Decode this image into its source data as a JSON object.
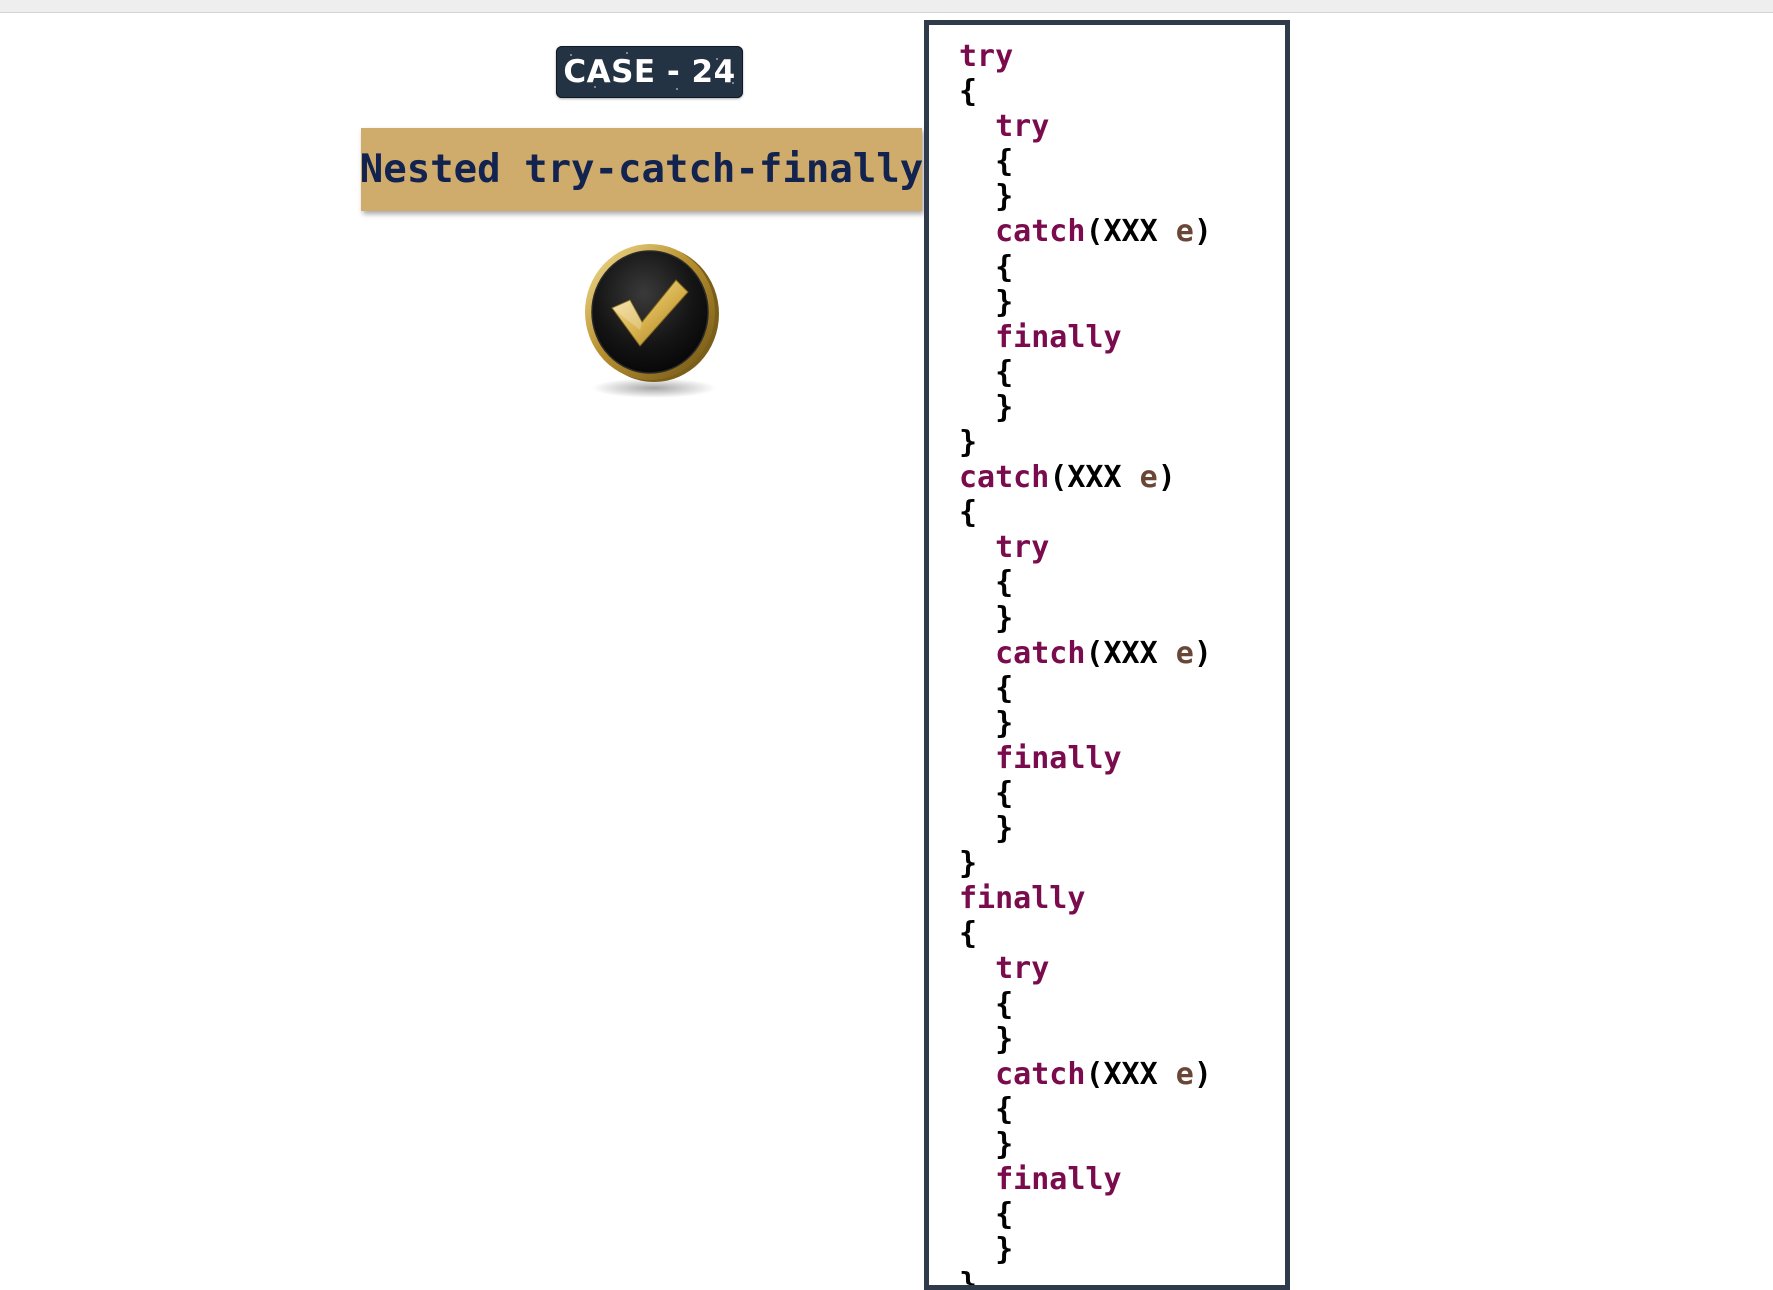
{
  "badge": {
    "label": "CASE - 24"
  },
  "title": {
    "text": "Nested try-catch-finally"
  },
  "icons": {
    "status": "checkmark-coin-icon"
  },
  "colors": {
    "badge_bg": "#243344",
    "banner_bg": "#cfac6b",
    "banner_text": "#13234f",
    "keyword": "#7a0c4e",
    "variable": "#6a4636",
    "panel_border": "#2f3b4a"
  },
  "code": {
    "lines": [
      [
        {
          "t": "kw",
          "v": "try"
        }
      ],
      [
        {
          "t": "punc",
          "v": "{"
        }
      ],
      [
        {
          "t": "kw",
          "v": "  try"
        }
      ],
      [
        {
          "t": "punc",
          "v": "  {"
        }
      ],
      [
        {
          "t": "punc",
          "v": "  }"
        }
      ],
      [
        {
          "t": "kw",
          "v": "  catch"
        },
        {
          "t": "punc",
          "v": "("
        },
        {
          "t": "type",
          "v": "XXX"
        },
        {
          "t": "var",
          "v": " e"
        },
        {
          "t": "punc",
          "v": ")"
        }
      ],
      [
        {
          "t": "punc",
          "v": "  {"
        }
      ],
      [
        {
          "t": "punc",
          "v": "  }"
        }
      ],
      [
        {
          "t": "kw",
          "v": "  finally"
        }
      ],
      [
        {
          "t": "punc",
          "v": "  {"
        }
      ],
      [
        {
          "t": "punc",
          "v": "  }"
        }
      ],
      [
        {
          "t": "punc",
          "v": "}"
        }
      ],
      [
        {
          "t": "kw",
          "v": "catch"
        },
        {
          "t": "punc",
          "v": "("
        },
        {
          "t": "type",
          "v": "XXX"
        },
        {
          "t": "var",
          "v": " e"
        },
        {
          "t": "punc",
          "v": ")"
        }
      ],
      [
        {
          "t": "punc",
          "v": "{"
        }
      ],
      [
        {
          "t": "kw",
          "v": "  try"
        }
      ],
      [
        {
          "t": "punc",
          "v": "  {"
        }
      ],
      [
        {
          "t": "punc",
          "v": "  }"
        }
      ],
      [
        {
          "t": "kw",
          "v": "  catch"
        },
        {
          "t": "punc",
          "v": "("
        },
        {
          "t": "type",
          "v": "XXX"
        },
        {
          "t": "var",
          "v": " e"
        },
        {
          "t": "punc",
          "v": ")"
        }
      ],
      [
        {
          "t": "punc",
          "v": "  {"
        }
      ],
      [
        {
          "t": "punc",
          "v": "  }"
        }
      ],
      [
        {
          "t": "kw",
          "v": "  finally"
        }
      ],
      [
        {
          "t": "punc",
          "v": "  {"
        }
      ],
      [
        {
          "t": "punc",
          "v": "  }"
        }
      ],
      [
        {
          "t": "punc",
          "v": "}"
        }
      ],
      [
        {
          "t": "kw",
          "v": "finally"
        }
      ],
      [
        {
          "t": "punc",
          "v": "{"
        }
      ],
      [
        {
          "t": "kw",
          "v": "  try"
        }
      ],
      [
        {
          "t": "punc",
          "v": "  {"
        }
      ],
      [
        {
          "t": "punc",
          "v": "  }"
        }
      ],
      [
        {
          "t": "kw",
          "v": "  catch"
        },
        {
          "t": "punc",
          "v": "("
        },
        {
          "t": "type",
          "v": "XXX"
        },
        {
          "t": "var",
          "v": " e"
        },
        {
          "t": "punc",
          "v": ")"
        }
      ],
      [
        {
          "t": "punc",
          "v": "  {"
        }
      ],
      [
        {
          "t": "punc",
          "v": "  }"
        }
      ],
      [
        {
          "t": "kw",
          "v": "  finally"
        }
      ],
      [
        {
          "t": "punc",
          "v": "  {"
        }
      ],
      [
        {
          "t": "punc",
          "v": "  }"
        }
      ],
      [
        {
          "t": "punc",
          "v": "}"
        }
      ]
    ]
  }
}
